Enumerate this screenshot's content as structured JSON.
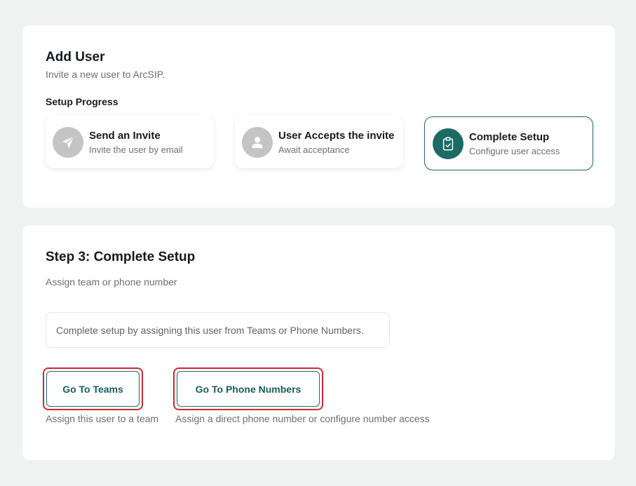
{
  "add_user": {
    "title": "Add User",
    "subtitle": "Invite a new user to ArcSIP.",
    "progress_label": "Setup Progress"
  },
  "steps": [
    {
      "name": "Send an Invite",
      "desc": "Invite the user by email",
      "icon": "paper-plane-icon",
      "state": "done"
    },
    {
      "name": "User Accepts the invite",
      "desc": "Await acceptance",
      "icon": "user-icon",
      "state": "done"
    },
    {
      "name": "Complete Setup",
      "desc": "Configure user access",
      "icon": "clipboard-check-icon",
      "state": "active"
    }
  ],
  "complete_setup": {
    "title": "Step 3: Complete Setup",
    "subtitle": "Assign team or phone number",
    "info": "Complete setup by assigning this user from Teams or Phone Numbers.",
    "teams_button": "Go To Teams",
    "teams_caption": "Assign this user to a team",
    "phone_button": "Go To Phone Numbers",
    "phone_caption": "Assign a direct phone number or configure number access"
  },
  "colors": {
    "accent": "#1c6a65",
    "highlight": "#cc2a33",
    "inactive_icon": "#c4c4c4",
    "background": "#eff2f1"
  }
}
